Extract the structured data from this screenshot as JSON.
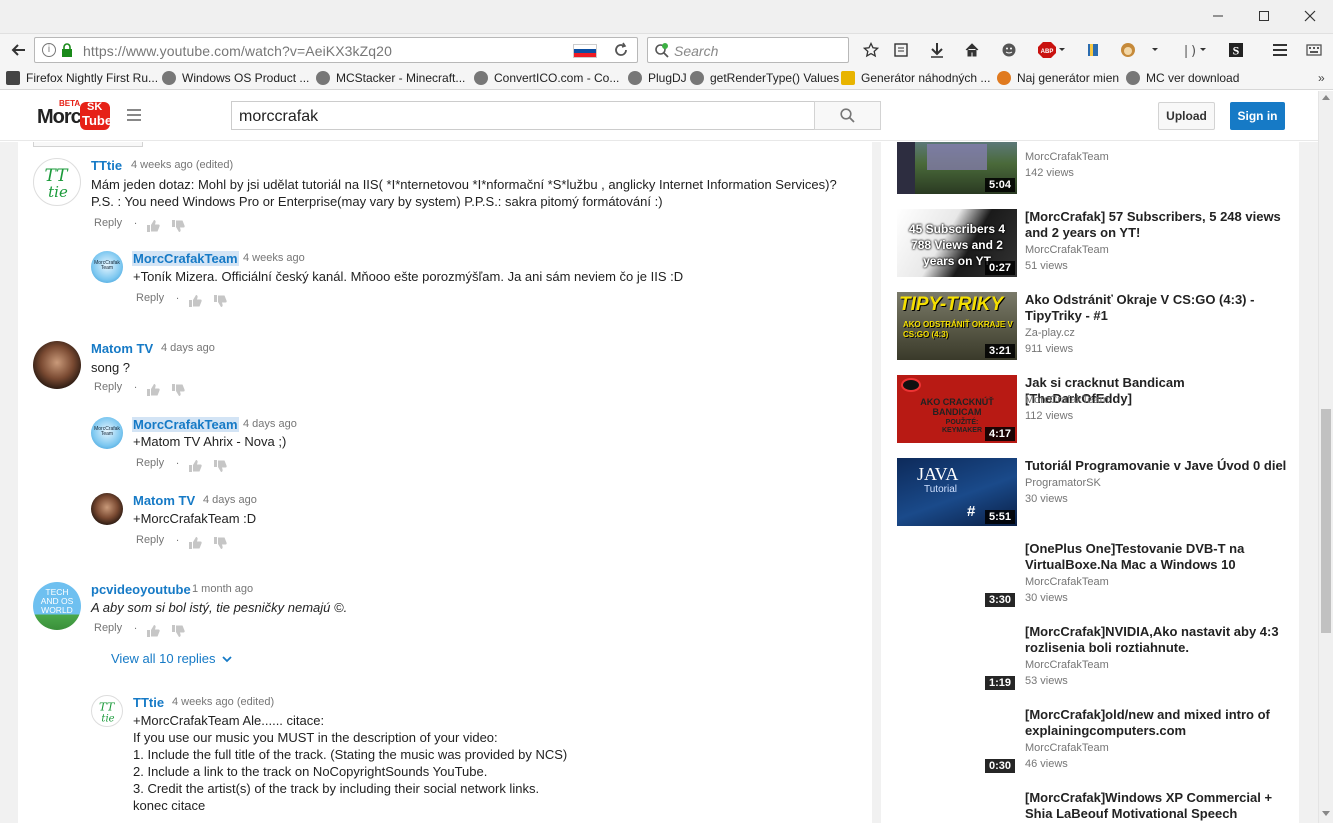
{
  "browser": {
    "url": "https://www.youtube.com/watch?v=AeiKX3kZq20",
    "search_placeholder": "Search",
    "bookmarks": [
      "Firefox Nightly First Ru...",
      "Windows OS Product ...",
      "MCStacker - Minecraft...",
      "ConvertICO.com - Co...",
      "PlugDJ",
      "getRenderType() Values",
      "Generátor náhodných ...",
      "Naj generátor mien",
      "MC ver download"
    ]
  },
  "yt": {
    "logo_text": "Morc",
    "logo_tube": "Tube",
    "logo_sk": "SK",
    "logo_beta": "BETA",
    "search_value": "morccrafak",
    "upload_label": "Upload",
    "signin_label": "Sign in"
  },
  "comments": [
    {
      "author": "TTtie",
      "time": "4 weeks ago (edited)",
      "lines": [
        "Mám jeden dotaz: Mohl by jsi udělat tutoriál na IIS( *I*nternetovou *I*nformační *S*lužbu , anglicky Internet Information Services)?",
        "P.S. : You need Windows Pro or Enterprise(may vary by system) P.P.S.: sakra pitomý formátování :)"
      ],
      "reply_label": "Reply"
    },
    {
      "author": "MorcCrafakTeam",
      "time": "4 weeks ago",
      "lines": [
        "+Toník Mizera. Officiální český kanál. Mňooo ešte porozmýšľam. Ja ani sám neviem čo je IIS :D"
      ],
      "reply_label": "Reply"
    },
    {
      "author": "Matom TV",
      "time": "4 days ago",
      "lines": [
        "song ?"
      ],
      "reply_label": "Reply"
    },
    {
      "author": "MorcCrafakTeam",
      "time": "4 days ago",
      "lines": [
        "+Matom TV Ahrix - Nova ;)"
      ],
      "reply_label": "Reply"
    },
    {
      "author": "Matom TV",
      "time": "4 days ago",
      "lines": [
        "+MorcCrafakTeam :D"
      ],
      "reply_label": "Reply"
    },
    {
      "author": "pcvideoyoutube",
      "time": "1 month ago",
      "lines": [
        "A aby som si bol istý, tie pesničky nemajú ©."
      ],
      "reply_label": "Reply"
    },
    {
      "author": "TTtie",
      "time": "4 weeks ago (edited)",
      "lines": [
        "+MorcCrafakTeam Ale...... citace:",
        "If you use our music you MUST in the description of your video:",
        "1. Include the full title of the track. (Stating the music was provided by NCS)",
        "2. Include a link to the track on NoCopyrightSounds YouTube.",
        "3. Credit the artist(s) of the track by including their social network links.",
        "konec citace"
      ],
      "reply_label": "Reply"
    }
  ],
  "view_replies_label": "View all 10 replies",
  "avatar_labels": {
    "tttie": "TT\ntie",
    "tech": "TECH\nAND OS\nWORLD",
    "morc": "MorcCrafak\nTeam"
  },
  "videos": [
    {
      "title": "",
      "channel": "MorcCrafakTeam",
      "views": "142 views",
      "duration": "5:04"
    },
    {
      "title": "[MorcCrafak] 57 Subscribers, 5 248 views and 2 years on YT!",
      "channel": "MorcCrafakTeam",
      "views": "51 views",
      "duration": "0:27",
      "thumb_text": "45 Subscribers 4 788 Views and 2 years on YT"
    },
    {
      "title": "Ako Odstrániť Okraje V CS:GO (4:3) - TipyTriky - #1",
      "channel": "Za-play.cz",
      "views": "911 views",
      "duration": "3:21",
      "thumb_text": "TIPY-TRIKY",
      "thumb_sub": "AKO ODSTRÁNIŤ OKRAJE V CS:GO (4:3)"
    },
    {
      "title": "Jak si cracknut Bandicam [TheDarkOfEddy]",
      "channel": "MorcCrafakTeam",
      "views": "112 views",
      "duration": "4:17",
      "thumb_text": "AKO CRACKNÚŤ BANDICAM",
      "thumb_sub": "POUŽITÉ: KEYMAKER"
    },
    {
      "title": "Tutoriál Programovanie v Jave Úvod 0 diel",
      "channel": "ProgramatorSK",
      "views": "30 views",
      "duration": "5:51",
      "thumb_text": "JAVA",
      "thumb_sub": "Tutorial"
    },
    {
      "title": "[OnePlus One]Testovanie DVB-T na VirtualBoxe.Na Mac a Windows 10",
      "channel": "MorcCrafakTeam",
      "views": "30 views",
      "duration": "3:30"
    },
    {
      "title": "[MorcCrafak]NVIDIA,Ako nastavit aby 4:3 rozlisenia boli roztiahnute.",
      "channel": "MorcCrafakTeam",
      "views": "53 views",
      "duration": "1:19"
    },
    {
      "title": "[MorcCrafak]old/new and mixed intro of explainingcomputers.com",
      "channel": "MorcCrafakTeam",
      "views": "46 views",
      "duration": "0:30"
    },
    {
      "title": "[MorcCrafak]Windows XP Commercial + Shia LaBeouf Motivational Speech",
      "channel": "",
      "views": "",
      "duration": ""
    }
  ],
  "colors": {
    "link_blue": "#167ac6",
    "signin_blue": "#167ac6",
    "highlight": "#d3e4f5",
    "logo_red": "#e62117"
  }
}
